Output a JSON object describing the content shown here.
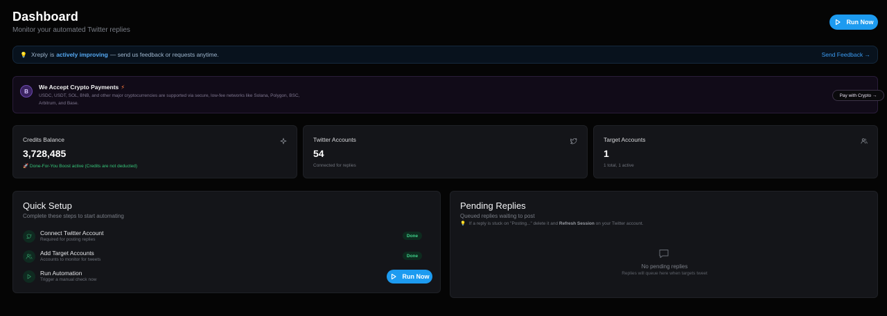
{
  "header": {
    "title": "Dashboard",
    "subtitle": "Monitor your automated Twitter replies",
    "run_now_label": "Run Now"
  },
  "info_banner": {
    "icon": "lightbulb-icon",
    "brand": "Xreply",
    "text_is": "is",
    "highlight": "actively improving",
    "text_rest": "— send us feedback or requests anytime.",
    "link_label": "Send Feedback →"
  },
  "crypto_banner": {
    "badge_letter": "B",
    "title": "We Accept Crypto Payments",
    "description": "USDC, USDT, SOL, BNB, and other major cryptocurrencies are supported via secure, low-fee networks like Solana, Polygon, BSC, Arbitrum, and Base.",
    "button_label": "Pay with Crypto →"
  },
  "stats": [
    {
      "label": "Credits Balance",
      "value": "3,728,485",
      "sub": "🚀 Done-For-You Boost active (Credits are not deducted)",
      "icon": "sparkle-icon"
    },
    {
      "label": "Twitter Accounts",
      "value": "54",
      "sub": "Connected for replies",
      "icon": "twitter-bird-icon"
    },
    {
      "label": "Target Accounts",
      "value": "1",
      "sub": "1 total, 1 active",
      "icon": "users-icon"
    }
  ],
  "quick_setup": {
    "title": "Quick Setup",
    "subtitle": "Complete these steps to start automating",
    "steps": [
      {
        "title": "Connect Twitter Account",
        "sub": "Required for posting replies",
        "status": "Done",
        "icon": "twitter-bird-icon"
      },
      {
        "title": "Add Target Accounts",
        "sub": "Accounts to monitor for tweets",
        "status": "Done",
        "icon": "users-icon"
      },
      {
        "title": "Run Automation",
        "sub": "Trigger a manual check now",
        "button": "Run Now",
        "icon": "play-icon"
      }
    ]
  },
  "pending_replies": {
    "title": "Pending Replies",
    "subtitle": "Queued replies waiting to post",
    "hint_a": "If a reply is stuck on \"Posting...\" delete it and",
    "hint_bold": "Refresh Session",
    "hint_b": "on your Twitter account.",
    "empty_title": "No pending replies",
    "empty_sub": "Replies will queue here when targets tweet"
  },
  "colors": {
    "accent": "#1d9bf0",
    "success": "#3fd08a",
    "background": "#050505",
    "card": "#141519"
  }
}
